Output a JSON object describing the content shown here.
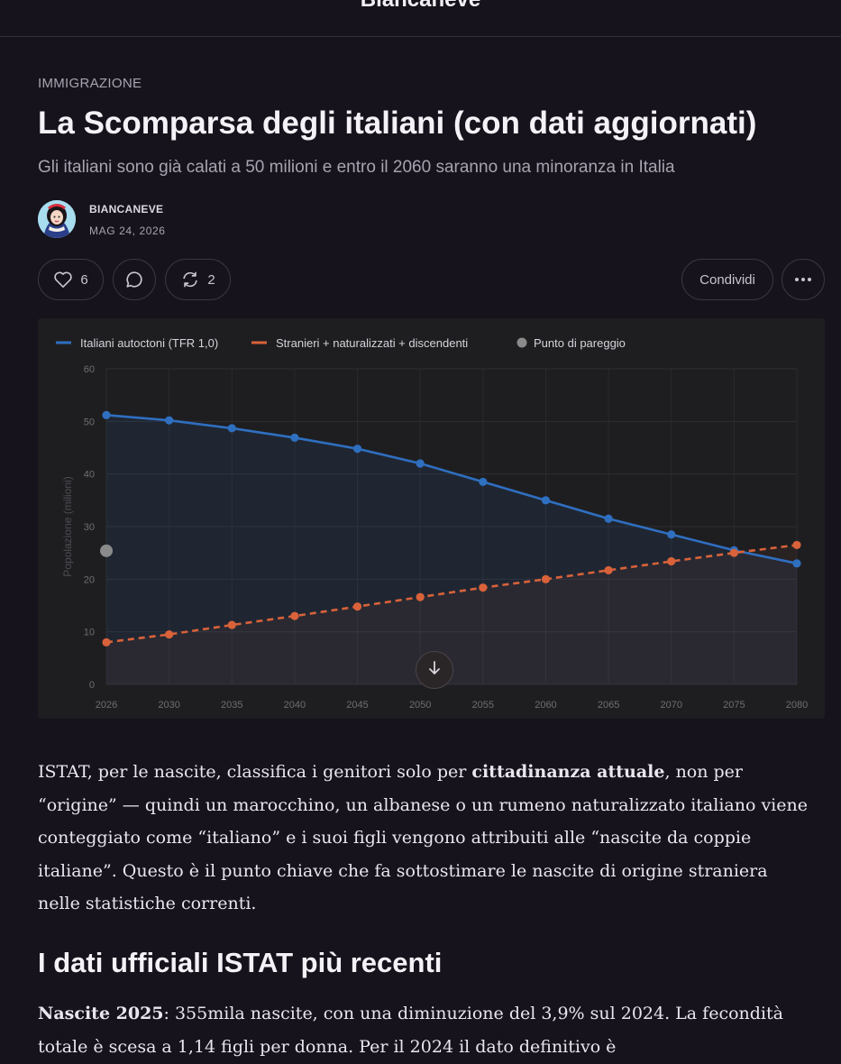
{
  "site": {
    "title": "Biancaneve"
  },
  "post": {
    "section": "IMMIGRAZIONE",
    "title": "La Scomparsa degli italiani (con dati aggiornati)",
    "subtitle": "Gli italiani sono già calati a 50 milioni e entro il 2060 saranno una minoranza in Italia",
    "author": "BIANCANEVE",
    "date": "MAG 24, 2026"
  },
  "actions": {
    "likes": "6",
    "restacks": "2",
    "share_label": "Condividi",
    "icons": [
      "heart-icon",
      "comment-icon",
      "restack-icon",
      "more-icon"
    ]
  },
  "chart_data": {
    "type": "line",
    "x": [
      2026,
      2030,
      2035,
      2040,
      2045,
      2050,
      2055,
      2060,
      2065,
      2070,
      2075,
      2080
    ],
    "series": [
      {
        "name": "Italiani autoctoni (TFR 1,0)",
        "color": "#2f6fc0",
        "style": "solid",
        "values": [
          51.2,
          50.2,
          48.7,
          46.9,
          44.8,
          42.0,
          38.5,
          35.0,
          31.5,
          28.5,
          25.5,
          23.0
        ]
      },
      {
        "name": "Stranieri + naturalizzati + discendenti",
        "color": "#d9623a",
        "style": "dashed",
        "values": [
          8.0,
          9.5,
          11.3,
          13.0,
          14.8,
          16.6,
          18.4,
          20.0,
          21.7,
          23.4,
          25.0,
          26.5
        ]
      }
    ],
    "marker_series": {
      "name": "Punto di pareggio",
      "color": "#8a8a8a",
      "x": 2026,
      "y": 25.4
    },
    "ylabel": "Popolazione (milioni)",
    "yticks": [
      0,
      10,
      20,
      30,
      40,
      50,
      60
    ],
    "xticks": [
      "2026",
      "2030",
      "2035",
      "2040",
      "2045",
      "2050",
      "2055",
      "2060",
      "2065",
      "2070",
      "2075",
      "2080"
    ],
    "ylim": [
      0,
      60
    ],
    "grid": true,
    "legend": "top-left"
  },
  "body": {
    "p1_a": "ISTAT, per le nascite, classifica i genitori solo per ",
    "p1_b": "cittadinanza attuale",
    "p1_c": ", non per “origine” — quindi un marocchino, un albanese o un rumeno naturalizzato italiano viene conteggiato come “italiano” e i suoi figli vengono attribuiti alle “nascite da coppie italiane”. Questo è il punto chiave che fa sottostimare le nascite di origine straniera nelle statistiche correnti.",
    "h2": "I dati ufficiali ISTAT più recenti",
    "p2_a": "Nascite 2025",
    "p2_b": ": 355mila nascite, con una diminuzione del 3,9% sul 2024. La fecondità totale è scesa a 1,14 figli per donna. Per il 2024 il dato definitivo è"
  }
}
